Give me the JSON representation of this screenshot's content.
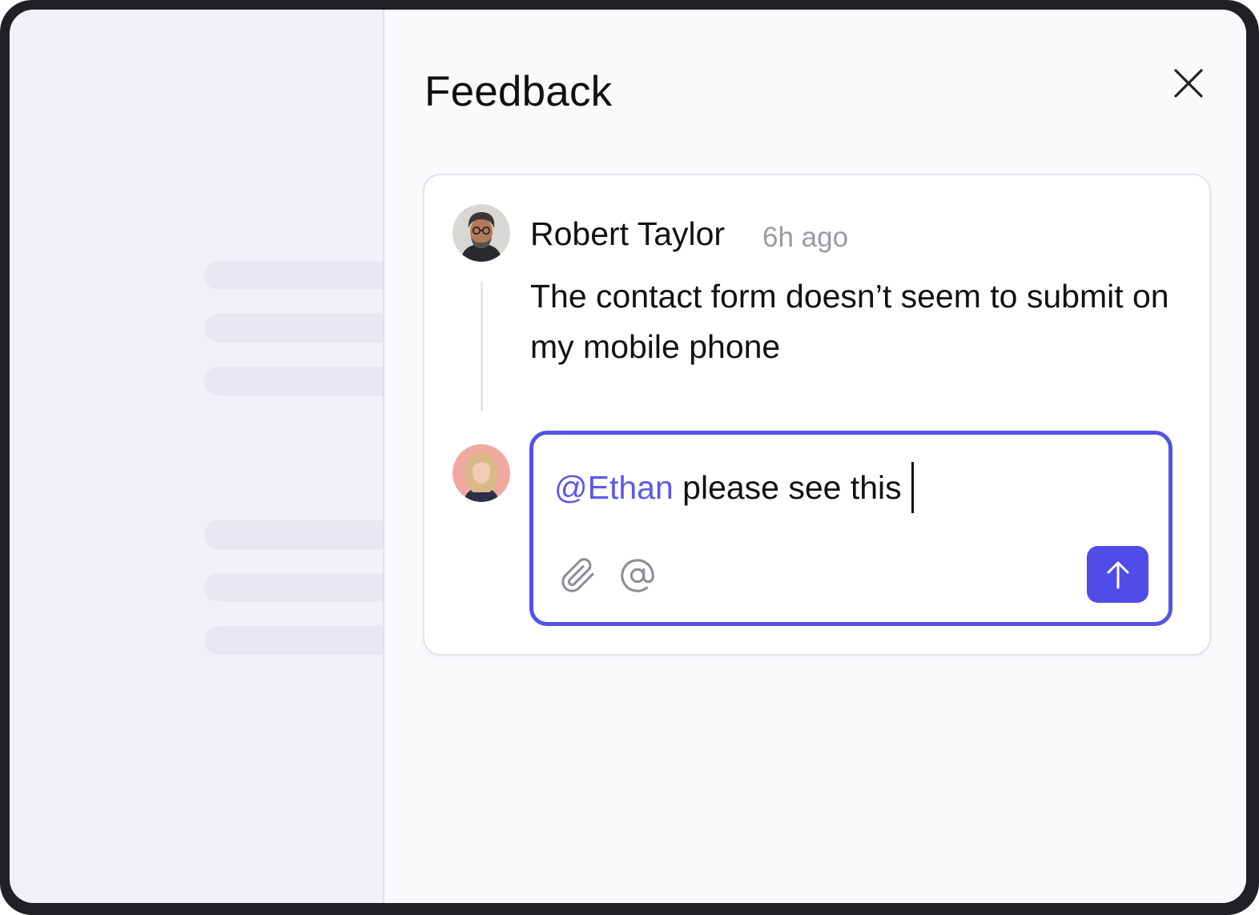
{
  "panel": {
    "title": "Feedback"
  },
  "comment": {
    "author": "Robert Taylor",
    "time": "6h ago",
    "message": "The contact form doesn’t seem to submit on my mobile phone"
  },
  "composer": {
    "mention": "@Ethan",
    "text": " please see this"
  },
  "icons": {
    "close": "close-icon",
    "attach": "paperclip-icon",
    "mention": "at-sign-icon",
    "send": "arrow-up-icon"
  },
  "colors": {
    "accent": "#4f4ce8",
    "mention": "#5b5ae8",
    "muted": "#9a99a3"
  }
}
